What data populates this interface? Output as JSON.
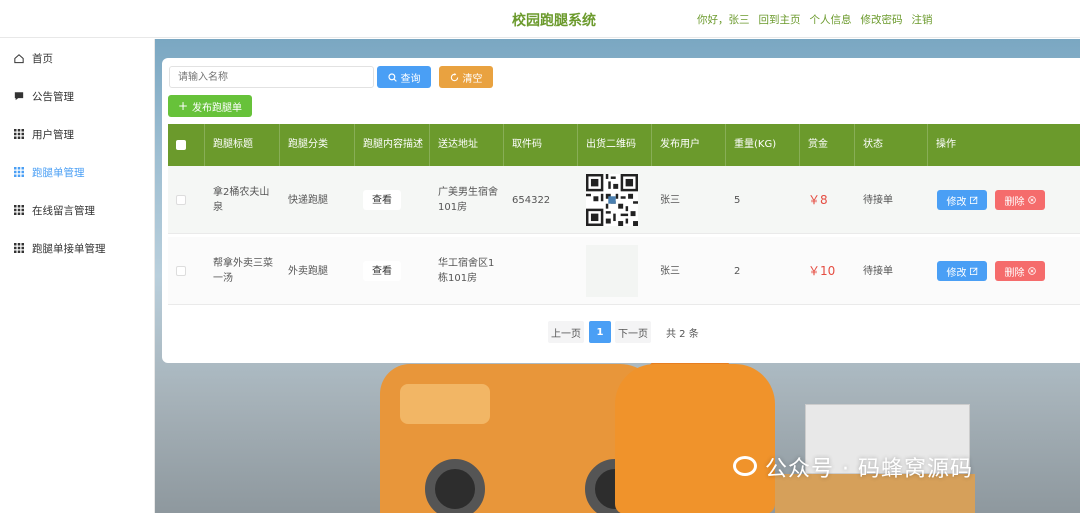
{
  "header": {
    "title": "校园跑腿系统",
    "links": [
      "你好，张三",
      "回到主页",
      "个人信息",
      "修改密码",
      "注销"
    ]
  },
  "sidebar": {
    "items": [
      {
        "label": "首页",
        "icon": "home-icon"
      },
      {
        "label": "公告管理",
        "icon": "chat-icon"
      },
      {
        "label": "用户管理",
        "icon": "grid-icon"
      },
      {
        "label": "跑腿单管理",
        "icon": "grid-icon",
        "active": true
      },
      {
        "label": "在线留言管理",
        "icon": "grid-icon"
      },
      {
        "label": "跑腿单接单管理",
        "icon": "grid-icon"
      }
    ]
  },
  "toolbar": {
    "search_placeholder": "请输入名称",
    "search_label": "查询",
    "clear_label": "清空",
    "publish_label": "发布跑腿单"
  },
  "table": {
    "headers": [
      "跑腿标题",
      "跑腿分类",
      "跑腿内容描述",
      "送达地址",
      "取件码",
      "出货二维码",
      "发布用户",
      "重量(KG)",
      "赏金",
      "状态",
      "操作"
    ],
    "rows": [
      {
        "title": "拿2桶农夫山泉",
        "category": "快递跑腿",
        "desc": "查看",
        "address": "广美男生宿舍101房",
        "code": "654322",
        "has_qr": true,
        "user": "张三",
        "weight": "5",
        "reward": "￥8",
        "status": "待接单",
        "edit": "修改",
        "delete": "删除"
      },
      {
        "title": "帮拿外卖三菜一汤",
        "category": "外卖跑腿",
        "desc": "查看",
        "address": "华工宿舍区1栋101房",
        "code": "",
        "has_qr": false,
        "user": "张三",
        "weight": "2",
        "reward": "￥10",
        "status": "待接单",
        "edit": "修改",
        "delete": "删除"
      }
    ]
  },
  "pagination": {
    "prev": "上一页",
    "current": "1",
    "next": "下一页",
    "total": "共 2 条"
  },
  "watermark": "公众号 · 码蜂窝源码",
  "colors": {
    "primary_green": "#6b9a2c",
    "blue": "#4a9ff5",
    "orange": "#e9a240",
    "red": "#f56c6c",
    "success": "#67c23a"
  }
}
